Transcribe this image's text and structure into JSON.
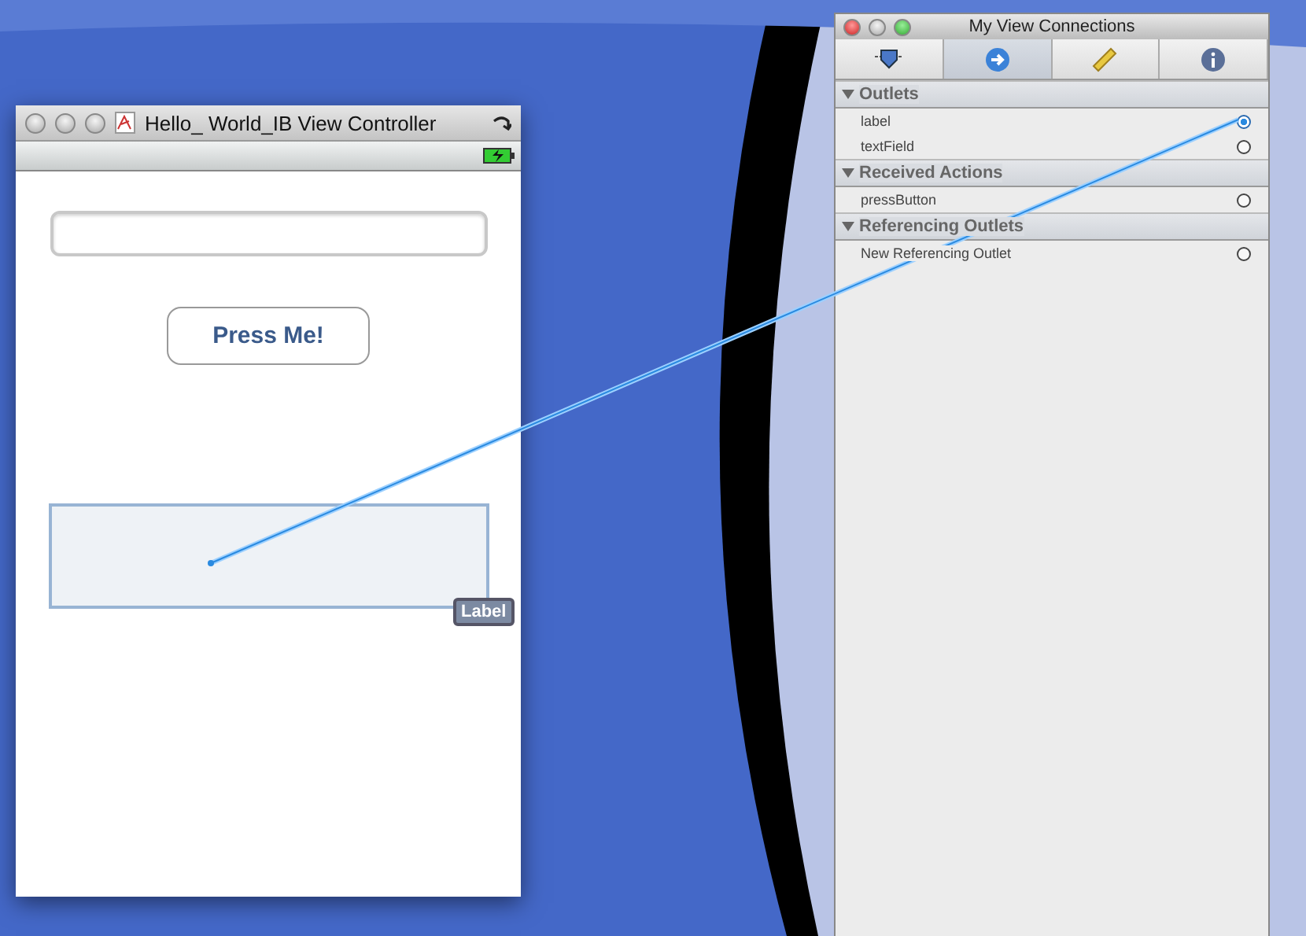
{
  "view_window": {
    "title": "Hello_ World_IB View Controller",
    "text_field": {
      "kind": "text"
    },
    "button": {
      "label": "Press Me!"
    },
    "label_badge": "Label"
  },
  "inspector": {
    "title": "My View Connections",
    "tabs": [
      {
        "kind": "attributes",
        "selected": false
      },
      {
        "kind": "connections",
        "selected": true
      },
      {
        "kind": "size",
        "selected": false
      },
      {
        "kind": "identity",
        "selected": false
      }
    ],
    "sections": [
      {
        "title": "Outlets",
        "expanded": true,
        "rows": [
          {
            "name": "label",
            "connected": true
          },
          {
            "name": "textField",
            "connected": false
          }
        ]
      },
      {
        "title": "Received Actions",
        "expanded": true,
        "rows": [
          {
            "name": "pressButton",
            "connected": false
          }
        ]
      },
      {
        "title": "Referencing Outlets",
        "expanded": true,
        "rows": [
          {
            "name": "New Referencing Outlet",
            "connected": false
          }
        ]
      }
    ]
  }
}
